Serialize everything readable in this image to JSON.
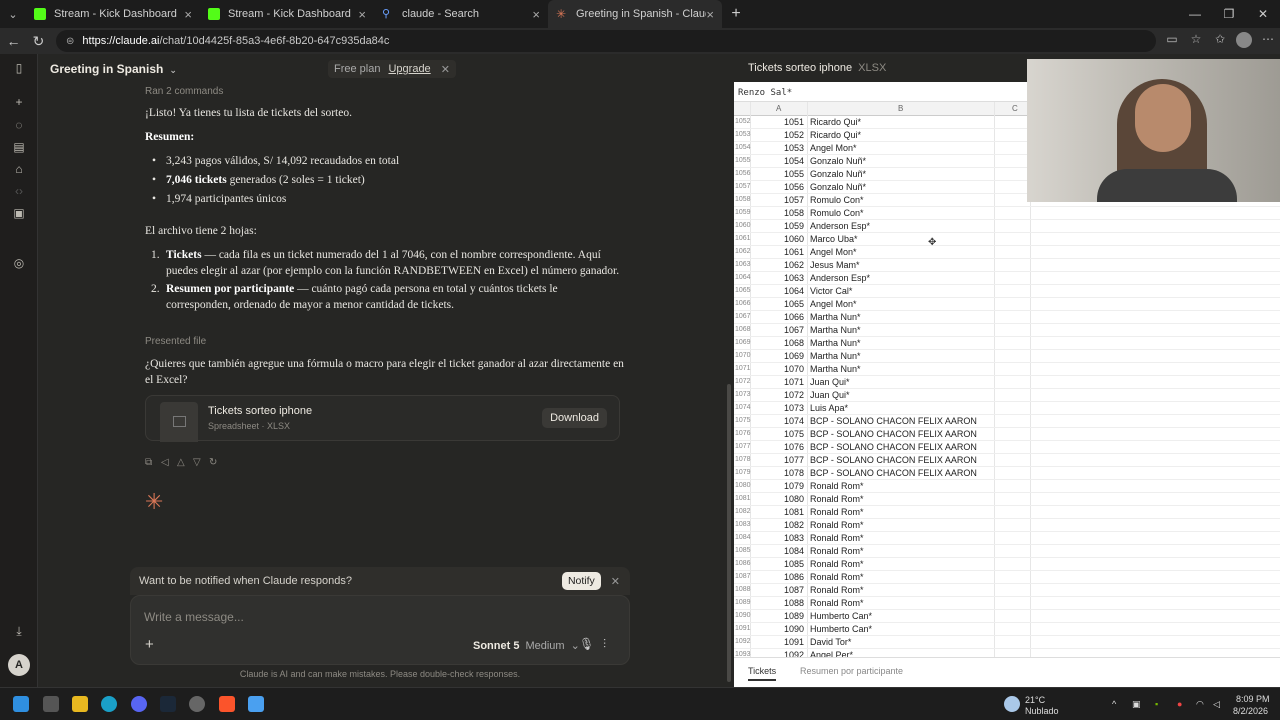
{
  "browser": {
    "tabs": [
      {
        "title": "Stream - Kick Dashboard",
        "icon": "kick-icon"
      },
      {
        "title": "Stream - Kick Dashboard",
        "icon": "kick-icon"
      },
      {
        "title": "claude - Search",
        "icon": "search-icon"
      },
      {
        "title": "Greeting in Spanish - Claude",
        "icon": "claude-icon"
      }
    ],
    "url_host": "https://claude.ai",
    "url_path": "/chat/10d4425f-85a3-4e6f-8b20-647c935da84c"
  },
  "chat": {
    "title": "Greeting in Spanish",
    "plan": "Free plan",
    "upgrade": "Upgrade",
    "ran_commands": "Ran 2 commands",
    "intro": "¡Listo! Ya tienes tu lista de tickets del sorteo.",
    "summary_heading": "Resumen:",
    "bullets": [
      {
        "bold": "",
        "text": "3,243 pagos válidos, S/ 14,092 recaudados en total"
      },
      {
        "bold": "7,046 tickets",
        "text": " generados (2 soles = 1 ticket)"
      },
      {
        "bold": "",
        "text": "1,974 participantes únicos"
      }
    ],
    "sheets_intro": "El archivo tiene 2 hojas:",
    "sheets": [
      {
        "num": "1.",
        "bold": "Tickets",
        "text": " — cada fila es un ticket numerado del 1 al 7046, con el nombre correspondiente. Aquí puedes elegir al azar (por ejemplo con la función RANDBETWEEN en Excel) el número ganador."
      },
      {
        "num": "2.",
        "bold": "Resumen por participante",
        "text": " — cuánto pagó cada persona en total y cuántos tickets le corresponden, ordenado de mayor a menor cantidad de tickets."
      }
    ],
    "presented_file": "Presented file",
    "question": "¿Quieres que también agregue una fórmula o macro para elegir el ticket ganador al azar directamente en el Excel?",
    "file": {
      "name": "Tickets sorteo iphone",
      "meta": "Spreadsheet · XLSX",
      "download": "Download"
    },
    "notify_text": "Want to be notified when Claude responds?",
    "notify_button": "Notify",
    "composer_placeholder": "Write a message...",
    "model": "Sonnet 5",
    "effort": "Medium",
    "disclaimer": "Claude is AI and can make mistakes. Please double-check responses.",
    "user_initial": "A"
  },
  "artifact": {
    "title": "Tickets sorteo iphone",
    "type": "XLSX",
    "formula": "Renzo Sal*",
    "columns": [
      "A",
      "B",
      "C"
    ],
    "sheet_tabs": [
      "Tickets",
      "Resumen por participante"
    ],
    "rows": [
      {
        "r": "1052",
        "t": "1051",
        "n": "Ricardo Qui*"
      },
      {
        "r": "1053",
        "t": "1052",
        "n": "Ricardo Qui*"
      },
      {
        "r": "1054",
        "t": "1053",
        "n": "Angel Mon*"
      },
      {
        "r": "1055",
        "t": "1054",
        "n": "Gonzalo Nuñ*"
      },
      {
        "r": "1056",
        "t": "1055",
        "n": "Gonzalo Nuñ*"
      },
      {
        "r": "1057",
        "t": "1056",
        "n": "Gonzalo Nuñ*"
      },
      {
        "r": "1058",
        "t": "1057",
        "n": "Romulo Con*"
      },
      {
        "r": "1059",
        "t": "1058",
        "n": "Romulo Con*"
      },
      {
        "r": "1060",
        "t": "1059",
        "n": "Anderson Esp*"
      },
      {
        "r": "1061",
        "t": "1060",
        "n": "Marco Uba*"
      },
      {
        "r": "1062",
        "t": "1061",
        "n": "Angel Mon*"
      },
      {
        "r": "1063",
        "t": "1062",
        "n": "Jesus Mam*"
      },
      {
        "r": "1064",
        "t": "1063",
        "n": "Anderson Esp*"
      },
      {
        "r": "1065",
        "t": "1064",
        "n": "Victor Cal*"
      },
      {
        "r": "1066",
        "t": "1065",
        "n": "Angel Mon*"
      },
      {
        "r": "1067",
        "t": "1066",
        "n": "Martha Nun*"
      },
      {
        "r": "1068",
        "t": "1067",
        "n": "Martha Nun*"
      },
      {
        "r": "1069",
        "t": "1068",
        "n": "Martha Nun*"
      },
      {
        "r": "1070",
        "t": "1069",
        "n": "Martha Nun*"
      },
      {
        "r": "1071",
        "t": "1070",
        "n": "Martha Nun*"
      },
      {
        "r": "1072",
        "t": "1071",
        "n": "Juan Qui*"
      },
      {
        "r": "1073",
        "t": "1072",
        "n": "Juan Qui*"
      },
      {
        "r": "1074",
        "t": "1073",
        "n": "Luis Apa*"
      },
      {
        "r": "1075",
        "t": "1074",
        "n": "BCP - SOLANO CHACON FELIX AARON"
      },
      {
        "r": "1076",
        "t": "1075",
        "n": "BCP - SOLANO CHACON FELIX AARON"
      },
      {
        "r": "1077",
        "t": "1076",
        "n": "BCP - SOLANO CHACON FELIX AARON"
      },
      {
        "r": "1078",
        "t": "1077",
        "n": "BCP - SOLANO CHACON FELIX AARON"
      },
      {
        "r": "1079",
        "t": "1078",
        "n": "BCP - SOLANO CHACON FELIX AARON"
      },
      {
        "r": "1080",
        "t": "1079",
        "n": "Ronald Rom*"
      },
      {
        "r": "1081",
        "t": "1080",
        "n": "Ronald Rom*"
      },
      {
        "r": "1082",
        "t": "1081",
        "n": "Ronald Rom*"
      },
      {
        "r": "1083",
        "t": "1082",
        "n": "Ronald Rom*"
      },
      {
        "r": "1084",
        "t": "1083",
        "n": "Ronald Rom*"
      },
      {
        "r": "1085",
        "t": "1084",
        "n": "Ronald Rom*"
      },
      {
        "r": "1086",
        "t": "1085",
        "n": "Ronald Rom*"
      },
      {
        "r": "1087",
        "t": "1086",
        "n": "Ronald Rom*"
      },
      {
        "r": "1088",
        "t": "1087",
        "n": "Ronald Rom*"
      },
      {
        "r": "1089",
        "t": "1088",
        "n": "Ronald Rom*"
      },
      {
        "r": "1090",
        "t": "1089",
        "n": "Humberto Can*"
      },
      {
        "r": "1091",
        "t": "1090",
        "n": "Humberto Can*"
      },
      {
        "r": "1092",
        "t": "1091",
        "n": "David Tor*"
      },
      {
        "r": "1093",
        "t": "1092",
        "n": "Angel Per*"
      }
    ]
  },
  "taskbar": {
    "weather_temp": "21°C",
    "weather_desc": "Nublado",
    "time": "8:09 PM",
    "date": "8/2/2026"
  },
  "colors": {
    "claude_accent": "#d97757",
    "kick_green": "#53fc18"
  }
}
